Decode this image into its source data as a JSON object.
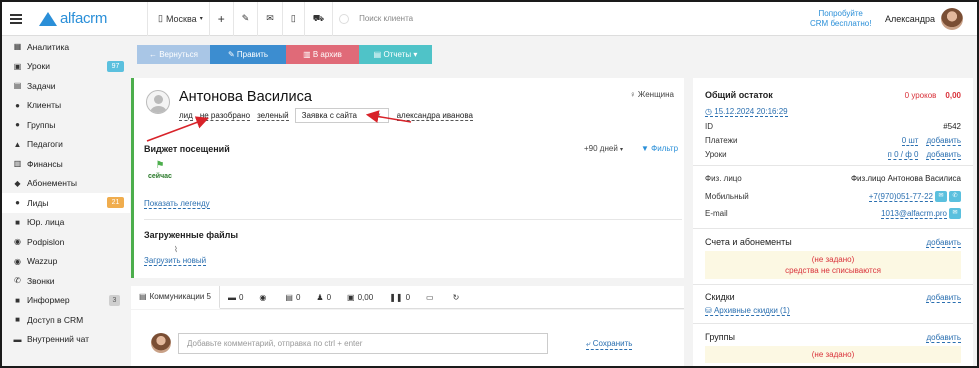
{
  "colors": {
    "accent": "#2a8fd8",
    "back_btn": "#a9c6e6",
    "edit_btn": "#3c8dd0",
    "archive_btn": "#e06a78",
    "reports_btn": "#4fc3c8",
    "lead_border": "#4cae4c",
    "red": "#d9323a",
    "lead_badge": "#f0ad4e",
    "lessons_badge": "#5bc0de",
    "informer_badge": "#cfcfcf"
  },
  "topbar": {
    "logo_text": "alfacrm",
    "city": "Москва",
    "search_placeholder": "Поиск клиента",
    "promo_line1": "Попробуйте",
    "promo_line2": "CRM бесплатно!",
    "user_name": "Александра",
    "icons": [
      "menu-icon",
      "plus-icon",
      "wrench-icon",
      "mail-icon",
      "phone-icon",
      "cart-icon"
    ]
  },
  "sidebar": {
    "items": [
      {
        "label": "Аналитика",
        "icon": "analytics-icon",
        "glyph": "▦"
      },
      {
        "label": "Уроки",
        "icon": "calendar-icon",
        "glyph": "▣",
        "badge": "97"
      },
      {
        "label": "Задачи",
        "icon": "tasks-icon",
        "glyph": "▤"
      },
      {
        "label": "Клиенты",
        "icon": "user-icon",
        "glyph": "●"
      },
      {
        "label": "Группы",
        "icon": "group-icon",
        "glyph": "●"
      },
      {
        "label": "Педагоги",
        "icon": "teacher-icon",
        "glyph": "▲"
      },
      {
        "label": "Финансы",
        "icon": "money-icon",
        "glyph": "▥"
      },
      {
        "label": "Абонементы",
        "icon": "tag-icon",
        "glyph": "◆"
      },
      {
        "label": "Лиды",
        "icon": "lead-icon",
        "glyph": "●",
        "badge": "21",
        "active": true
      },
      {
        "label": "Юр. лица",
        "icon": "building-icon",
        "glyph": "■"
      },
      {
        "label": "Podpislon",
        "icon": "podpislon-icon",
        "glyph": "◉"
      },
      {
        "label": "Wazzup",
        "icon": "whatsapp-icon",
        "glyph": "◉"
      },
      {
        "label": "Звонки",
        "icon": "phone-icon",
        "glyph": "✆"
      },
      {
        "label": "Информер",
        "icon": "informer-icon",
        "glyph": "■",
        "badge": "3"
      },
      {
        "label": "Доступ в CRM",
        "icon": "lock-icon",
        "glyph": "■"
      },
      {
        "label": "Внутренний чат",
        "icon": "chat-icon",
        "glyph": "▬"
      }
    ]
  },
  "actions": {
    "back": "← Вернуться",
    "edit": "✎ Править",
    "archive": "▥ В архив",
    "reports": "▤ Отчеты ▾"
  },
  "lead": {
    "name": "Антонова Василиса",
    "gender": "♀ Женщина",
    "tag_lead": "лид",
    "tag_status": "не разобрано",
    "tag_color": "зеленый",
    "source_select": "Заявка с сайта",
    "manager": "александра иванова"
  },
  "visits": {
    "title": "Виджет посещений",
    "period": "+90 дней",
    "filter": "Фильтр",
    "now_label": "сейчас",
    "legend_link": "Показать легенду"
  },
  "files": {
    "title": "Загруженные файлы",
    "upload_link": "Загрузить новый"
  },
  "communications": {
    "active_tab": "Коммуникации 5",
    "tabs": [
      {
        "icon": "comment-icon",
        "glyph": "▬",
        "count": "0"
      },
      {
        "icon": "whatsapp-icon",
        "glyph": "◉",
        "count": ""
      },
      {
        "icon": "document-icon",
        "glyph": "▤",
        "count": "0"
      },
      {
        "icon": "person-icon",
        "glyph": "♟",
        "count": "0"
      },
      {
        "icon": "wallet-icon",
        "glyph": "▣",
        "count": "0,00"
      },
      {
        "icon": "pause-icon",
        "glyph": "❚❚",
        "count": "0"
      },
      {
        "icon": "video-icon",
        "glyph": "▭",
        "count": ""
      },
      {
        "icon": "history-icon",
        "glyph": "↻",
        "count": ""
      }
    ],
    "comment_placeholder": "Добавьте комментарий, отправка по ctrl + enter",
    "save_link": "Сохранить"
  },
  "summary": {
    "title": "Общий остаток",
    "balance_lessons": "0 уроков",
    "balance_money": "0,00",
    "date": "15.12.2024 20:16:29",
    "id_label": "ID",
    "id_value": "#542",
    "payments_label": "Платежи",
    "payments_value": "0 шт",
    "payments_add": "добавить",
    "lessons_label": "Уроки",
    "lessons_value": "п 0 / ф 0",
    "lessons_add": "добавить",
    "person_label": "Физ. лицо",
    "person_value": "Физ.лицо Антонова Василиса",
    "mobile_label": "Мобильный",
    "mobile_value": "+7(970)051-77-22",
    "email_label": "E-mail",
    "email_value": "1013@alfacrm.pro"
  },
  "accounts": {
    "title": "Счета и абонементы",
    "add": "добавить",
    "not_set": "(не задано)",
    "no_charge": "средства не списываются"
  },
  "discounts": {
    "title": "Скидки",
    "add": "добавить",
    "archive": "Архивные скидки (1)"
  },
  "groups": {
    "title": "Группы",
    "add": "добавить",
    "not_set": "(не задано)"
  }
}
